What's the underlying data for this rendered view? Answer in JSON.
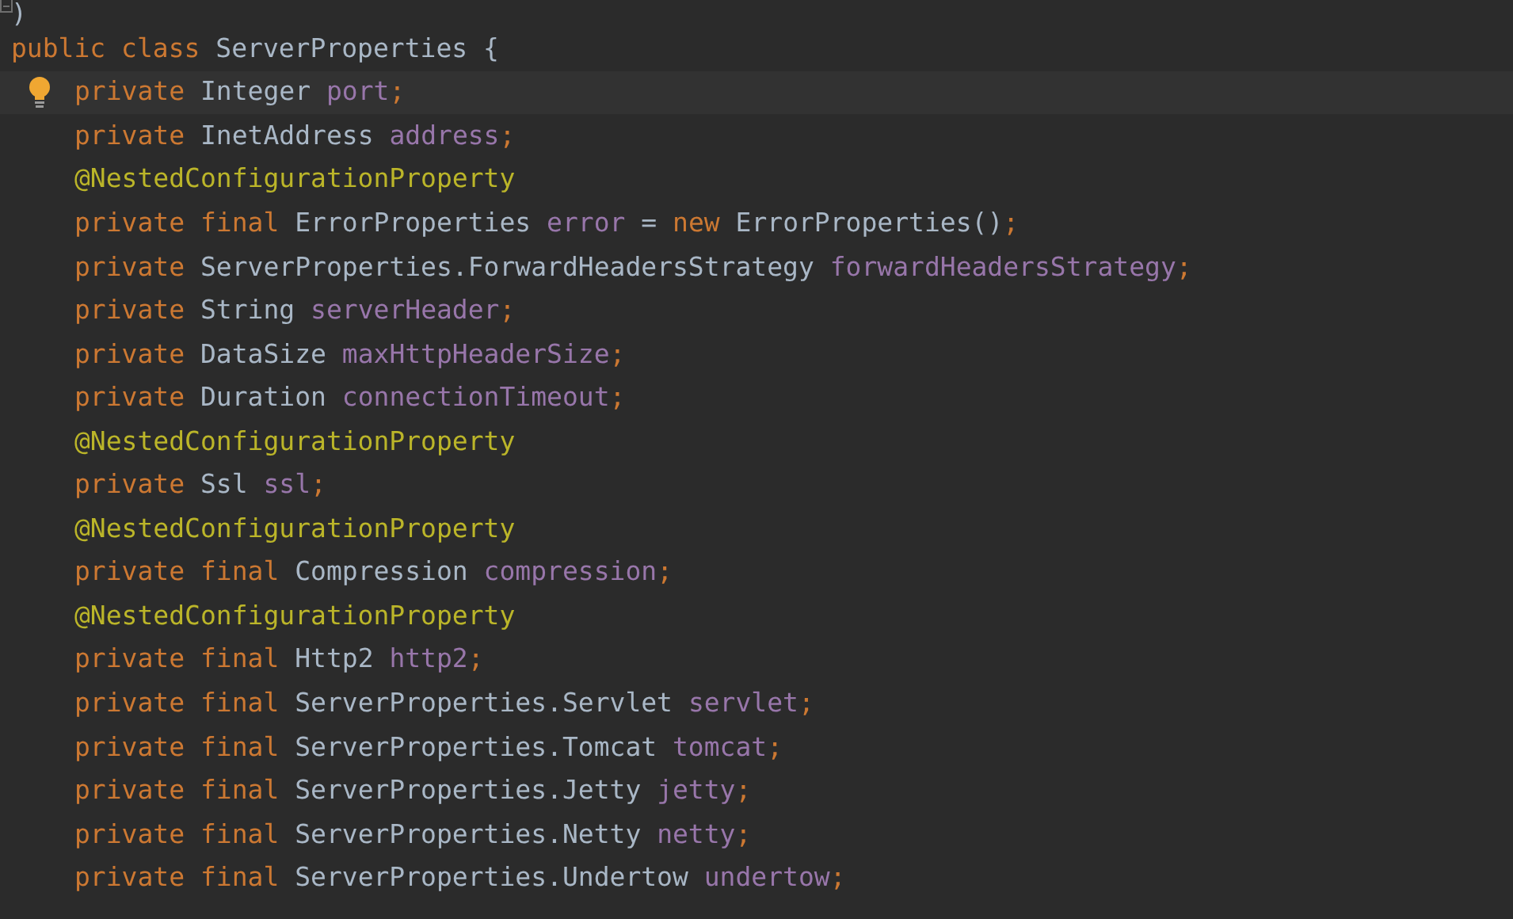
{
  "editor": {
    "lines": [
      {
        "tokens": [
          {
            "kind": "plain",
            "text": ")"
          }
        ]
      },
      {
        "tokens": [
          {
            "kind": "keyword",
            "text": "public class "
          },
          {
            "kind": "plain",
            "text": "ServerProperties {"
          }
        ],
        "children": [
          {
            "current": true,
            "bulb": true,
            "tokens": [
              {
                "kind": "keyword",
                "text": "private "
              },
              {
                "kind": "plain",
                "text": "Integer "
              },
              {
                "kind": "field",
                "text": "port"
              },
              {
                "kind": "keyword",
                "text": ";"
              }
            ]
          },
          {
            "current": false,
            "bulb": false,
            "tokens": [
              {
                "kind": "keyword",
                "text": "private "
              },
              {
                "kind": "plain",
                "text": "InetAddress "
              },
              {
                "kind": "field",
                "text": "address"
              },
              {
                "kind": "keyword",
                "text": ";"
              }
            ]
          },
          {
            "current": false,
            "bulb": false,
            "tokens": [
              {
                "kind": "annotation",
                "text": "@NestedConfigurationProperty"
              }
            ]
          },
          {
            "current": false,
            "bulb": false,
            "tokens": [
              {
                "kind": "keyword",
                "text": "private final "
              },
              {
                "kind": "plain",
                "text": "ErrorProperties "
              },
              {
                "kind": "field",
                "text": "error"
              },
              {
                "kind": "plain",
                "text": " = "
              },
              {
                "kind": "keyword",
                "text": "new "
              },
              {
                "kind": "plain",
                "text": "ErrorProperties()"
              },
              {
                "kind": "keyword",
                "text": ";"
              }
            ]
          },
          {
            "current": false,
            "bulb": false,
            "tokens": [
              {
                "kind": "keyword",
                "text": "private "
              },
              {
                "kind": "plain",
                "text": "ServerProperties.ForwardHeadersStrategy "
              },
              {
                "kind": "field",
                "text": "forwardHeadersStrategy"
              },
              {
                "kind": "keyword",
                "text": ";"
              }
            ]
          },
          {
            "current": false,
            "bulb": false,
            "tokens": [
              {
                "kind": "keyword",
                "text": "private "
              },
              {
                "kind": "plain",
                "text": "String "
              },
              {
                "kind": "field",
                "text": "serverHeader"
              },
              {
                "kind": "keyword",
                "text": ";"
              }
            ]
          },
          {
            "current": false,
            "bulb": false,
            "tokens": [
              {
                "kind": "keyword",
                "text": "private "
              },
              {
                "kind": "plain",
                "text": "DataSize "
              },
              {
                "kind": "field",
                "text": "maxHttpHeaderSize"
              },
              {
                "kind": "keyword",
                "text": ";"
              }
            ]
          },
          {
            "current": false,
            "bulb": false,
            "tokens": [
              {
                "kind": "keyword",
                "text": "private "
              },
              {
                "kind": "plain",
                "text": "Duration "
              },
              {
                "kind": "field",
                "text": "connectionTimeout"
              },
              {
                "kind": "keyword",
                "text": ";"
              }
            ]
          },
          {
            "current": false,
            "bulb": false,
            "tokens": [
              {
                "kind": "annotation",
                "text": "@NestedConfigurationProperty"
              }
            ]
          },
          {
            "current": false,
            "bulb": false,
            "tokens": [
              {
                "kind": "keyword",
                "text": "private "
              },
              {
                "kind": "plain",
                "text": "Ssl "
              },
              {
                "kind": "field",
                "text": "ssl"
              },
              {
                "kind": "keyword",
                "text": ";"
              }
            ]
          },
          {
            "current": false,
            "bulb": false,
            "tokens": [
              {
                "kind": "annotation",
                "text": "@NestedConfigurationProperty"
              }
            ]
          },
          {
            "current": false,
            "bulb": false,
            "tokens": [
              {
                "kind": "keyword",
                "text": "private final "
              },
              {
                "kind": "plain",
                "text": "Compression "
              },
              {
                "kind": "field",
                "text": "compression"
              },
              {
                "kind": "keyword",
                "text": ";"
              }
            ]
          },
          {
            "current": false,
            "bulb": false,
            "tokens": [
              {
                "kind": "annotation",
                "text": "@NestedConfigurationProperty"
              }
            ]
          },
          {
            "current": false,
            "bulb": false,
            "tokens": [
              {
                "kind": "keyword",
                "text": "private final "
              },
              {
                "kind": "plain",
                "text": "Http2 "
              },
              {
                "kind": "field",
                "text": "http2"
              },
              {
                "kind": "keyword",
                "text": ";"
              }
            ]
          },
          {
            "current": false,
            "bulb": false,
            "tokens": [
              {
                "kind": "keyword",
                "text": "private final "
              },
              {
                "kind": "plain",
                "text": "ServerProperties.Servlet "
              },
              {
                "kind": "field",
                "text": "servlet"
              },
              {
                "kind": "keyword",
                "text": ";"
              }
            ]
          },
          {
            "current": false,
            "bulb": false,
            "tokens": [
              {
                "kind": "keyword",
                "text": "private final "
              },
              {
                "kind": "plain",
                "text": "ServerProperties.Tomcat "
              },
              {
                "kind": "field",
                "text": "tomcat"
              },
              {
                "kind": "keyword",
                "text": ";"
              }
            ]
          },
          {
            "current": false,
            "bulb": false,
            "tokens": [
              {
                "kind": "keyword",
                "text": "private final "
              },
              {
                "kind": "plain",
                "text": "ServerProperties.Jetty "
              },
              {
                "kind": "field",
                "text": "jetty"
              },
              {
                "kind": "keyword",
                "text": ";"
              }
            ]
          },
          {
            "current": false,
            "bulb": false,
            "tokens": [
              {
                "kind": "keyword",
                "text": "private final "
              },
              {
                "kind": "plain",
                "text": "ServerProperties.Netty "
              },
              {
                "kind": "field",
                "text": "netty"
              },
              {
                "kind": "keyword",
                "text": ";"
              }
            ]
          },
          {
            "current": false,
            "bulb": false,
            "tokens": [
              {
                "kind": "keyword",
                "text": "private final "
              },
              {
                "kind": "plain",
                "text": "ServerProperties.Undertow "
              },
              {
                "kind": "field",
                "text": "undertow"
              },
              {
                "kind": "keyword",
                "text": ";"
              }
            ]
          }
        ]
      }
    ]
  }
}
